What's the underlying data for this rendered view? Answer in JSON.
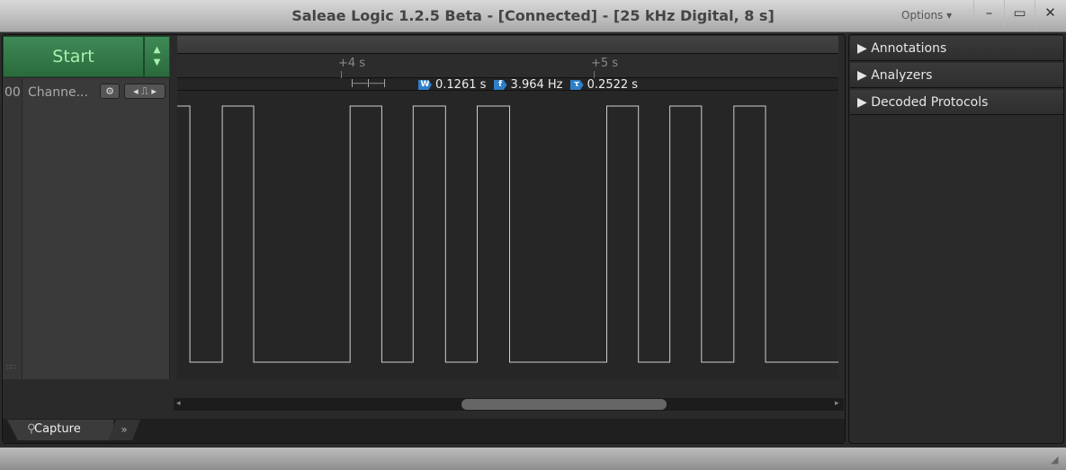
{
  "window": {
    "title": "Saleae Logic 1.2.5 Beta - [Connected] - [25 kHz Digital, 8 s]",
    "options_label": "Options ▾",
    "minimize": "–",
    "maximize": "▭",
    "close": "✕"
  },
  "toolbar": {
    "start_label": "Start"
  },
  "channels": [
    {
      "index": "00",
      "name": "Channe..."
    }
  ],
  "ruler": {
    "ticks": [
      {
        "label": "+4 s",
        "t": 4
      },
      {
        "label": "+5 s",
        "t": 5
      }
    ]
  },
  "measurement": {
    "width_badge": "W",
    "width": "0.1261 s",
    "freq_badge": "f",
    "frequency": "3.964 Hz",
    "period_badge": "τ",
    "period": "0.2522 s"
  },
  "signal": {
    "view_start_s": 3.356,
    "view_end_s": 5.968,
    "initial_level": 1,
    "transitions_s": [
      3.406,
      3.534,
      3.658,
      4.039,
      4.164,
      4.288,
      4.416,
      4.541,
      4.669,
      5.053,
      5.178,
      5.302,
      5.427,
      5.555,
      5.68
    ]
  },
  "tabs": {
    "capture": "Capture",
    "more": "»"
  },
  "sidebar": {
    "sections": [
      {
        "label": "Annotations"
      },
      {
        "label": "Analyzers"
      },
      {
        "label": "Decoded Protocols"
      }
    ]
  },
  "colors": {
    "accent_green": "#2f7a47",
    "badge_blue": "#2f7fc9",
    "signal": "#cfcfcf"
  }
}
